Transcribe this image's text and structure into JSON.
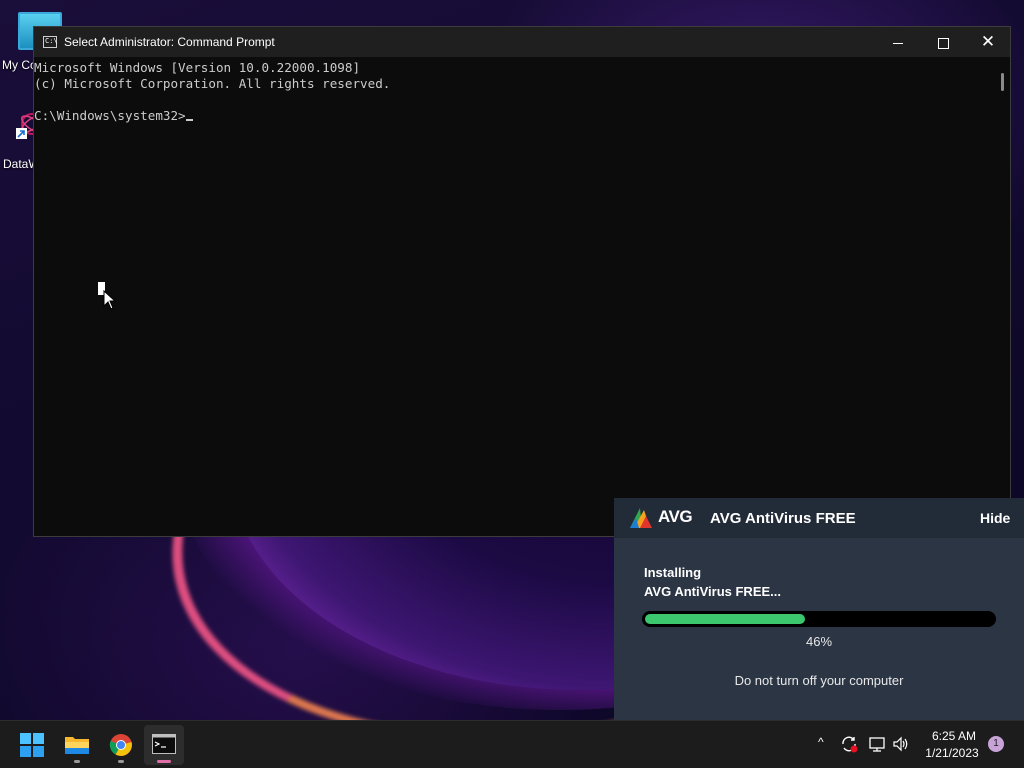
{
  "desktop": {
    "icons": [
      {
        "label": "My Co"
      },
      {
        "label": "DataW"
      }
    ]
  },
  "cmd_window": {
    "title": "Select Administrator:  Command Prompt",
    "lines": [
      "Microsoft Windows [Version 10.0.22000.1098]",
      "(c) Microsoft Corporation. All rights reserved.",
      "",
      "C:\\Windows\\system32>"
    ],
    "min_icon": "minimize-icon",
    "max_icon": "maximize-icon",
    "close_icon": "close-icon",
    "close_glyph": "✕"
  },
  "avg_notification": {
    "logo_text": "AVG",
    "title": "AVG AntiVirus FREE",
    "hide_label": "Hide",
    "status_line1": "Installing",
    "status_line2": "AVG AntiVirus FREE...",
    "progress_percent": 46,
    "progress_label": "46%",
    "note": "Do not turn off your computer",
    "accent_color": "#3cc76f",
    "background_color": "#2b3544"
  },
  "taskbar": {
    "apps": [
      "start-icon",
      "file-explorer-icon",
      "chrome-icon",
      "command-prompt-icon"
    ],
    "tray": {
      "chevron": "^",
      "time": "6:25 AM",
      "date": "1/21/2023",
      "notification_count": "1"
    }
  }
}
